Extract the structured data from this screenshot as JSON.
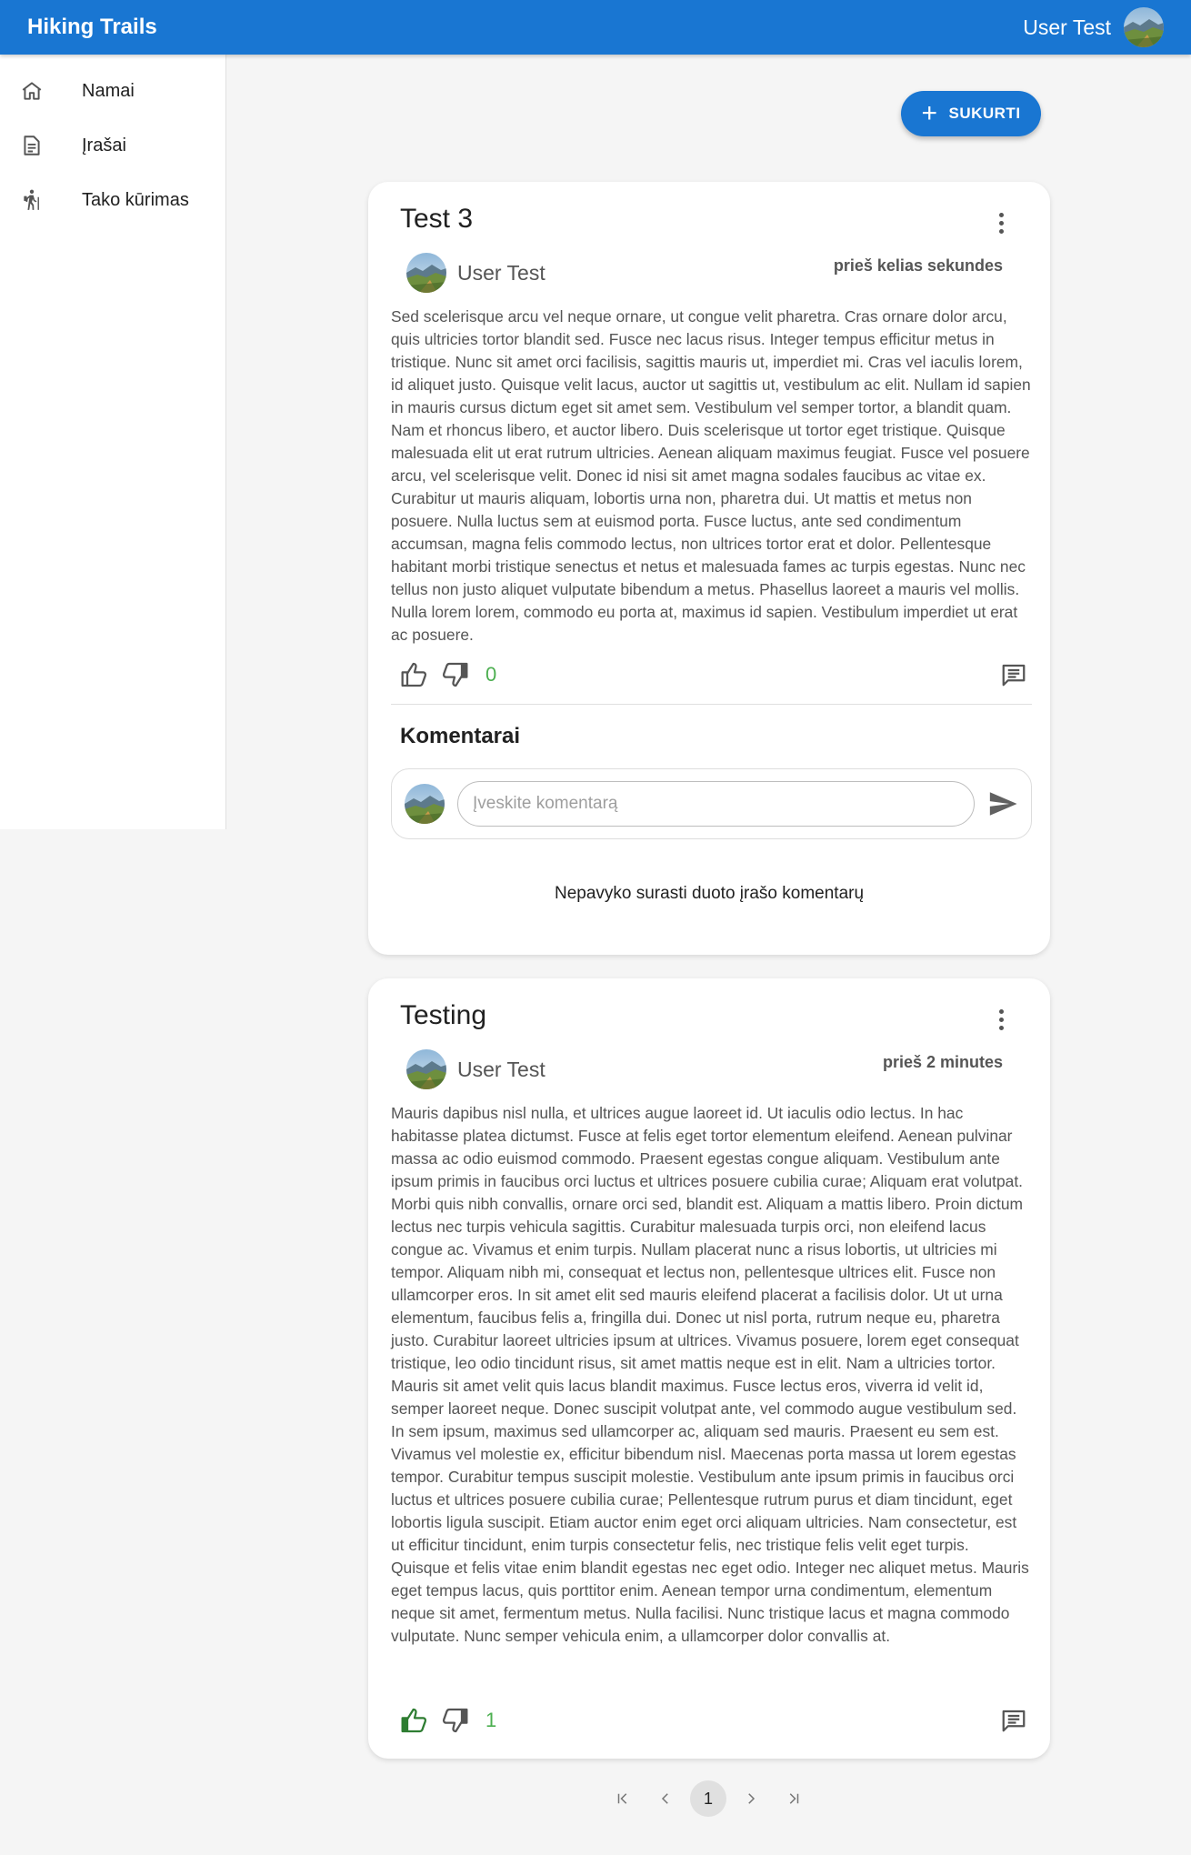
{
  "app": {
    "title": "Hiking Trails",
    "user_name": "User Test"
  },
  "sidebar": {
    "items": [
      {
        "label": "Namai",
        "icon": "home-icon"
      },
      {
        "label": "Įrašai",
        "icon": "article-icon"
      },
      {
        "label": "Tako kūrimas",
        "icon": "hiking-icon"
      }
    ]
  },
  "toolbar": {
    "create_label": "SUKURTI"
  },
  "posts": [
    {
      "title": "Test 3",
      "author": "User Test",
      "time": "prieš kelias sekundes",
      "body": "Sed scelerisque arcu vel neque ornare, ut congue velit pharetra. Cras ornare dolor arcu, quis ultricies tortor blandit sed. Fusce nec lacus risus. Integer tempus efficitur metus in tristique. Nunc sit amet orci facilisis, sagittis mauris ut, imperdiet mi. Cras vel iaculis lorem, id aliquet justo. Quisque velit lacus, auctor ut sagittis ut, vestibulum ac elit. Nullam id sapien in mauris cursus dictum eget sit amet sem. Vestibulum vel semper tortor, a blandit quam. Nam et rhoncus libero, et auctor libero. Duis scelerisque ut tortor eget tristique. Quisque malesuada elit ut erat rutrum ultricies. Aenean aliquam maximus feugiat. Fusce vel posuere arcu, vel scelerisque velit. Donec id nisi sit amet magna sodales faucibus ac vitae ex. Curabitur ut mauris aliquam, lobortis urna non, pharetra dui. Ut mattis et metus non posuere. Nulla luctus sem at euismod porta. Fusce luctus, ante sed condimentum accumsan, magna felis commodo lectus, non ultrices tortor erat et dolor. Pellentesque habitant morbi tristique senectus et netus et malesuada fames ac turpis egestas. Nunc nec tellus non justo aliquet vulputate bibendum a metus. Phasellus laoreet a mauris vel mollis. Nulla lorem lorem, commodo eu porta at, maximus id sapien. Vestibulum imperdiet ut erat ac posuere.",
      "likes": "0",
      "liked": false,
      "comments_heading": "Komentarai",
      "comment_placeholder": "Įveskite komentarą",
      "comments_empty": "Nepavyko surasti duoto įrašo komentarų"
    },
    {
      "title": "Testing",
      "author": "User Test",
      "time": "prieš 2 minutes",
      "body": "Mauris dapibus nisl nulla, et ultrices augue laoreet id. Ut iaculis odio lectus. In hac habitasse platea dictumst. Fusce at felis eget tortor elementum eleifend. Aenean pulvinar massa ac odio euismod commodo. Praesent egestas congue aliquam. Vestibulum ante ipsum primis in faucibus orci luctus et ultrices posuere cubilia curae; Aliquam erat volutpat. Morbi quis nibh convallis, ornare orci sed, blandit est. Aliquam a mattis libero. Proin dictum lectus nec turpis vehicula sagittis. Curabitur malesuada turpis orci, non eleifend lacus congue ac. Vivamus et enim turpis. Nullam placerat nunc a risus lobortis, ut ultricies mi tempor. Aliquam nibh mi, consequat et lectus non, pellentesque ultrices elit. Fusce non ullamcorper eros. In sit amet elit sed mauris eleifend placerat a facilisis dolor. Ut ut urna elementum, faucibus felis a, fringilla dui. Donec ut nisl porta, rutrum neque eu, pharetra justo. Curabitur laoreet ultricies ipsum at ultrices. Vivamus posuere, lorem eget consequat tristique, leo odio tincidunt risus, sit amet mattis neque est in elit. Nam a ultricies tortor. Mauris sit amet velit quis lacus blandit maximus. Fusce lectus eros, viverra id velit id, semper laoreet neque. Donec suscipit volutpat ante, vel commodo augue vestibulum sed. In sem ipsum, maximus sed ullamcorper ac, aliquam sed mauris. Praesent eu sem est. Vivamus vel molestie ex, efficitur bibendum nisl. Maecenas porta massa ut lorem egestas tempor. Curabitur tempus suscipit molestie. Vestibulum ante ipsum primis in faucibus orci luctus et ultrices posuere cubilia curae; Pellentesque rutrum purus et diam tincidunt, eget lobortis ligula suscipit. Etiam auctor enim eget orci aliquam ultricies. Nam consectetur, est ut efficitur tincidunt, enim turpis consectetur felis, nec tristique felis velit eget turpis. Quisque et felis vitae enim blandit egestas nec eget odio. Integer nec aliquet metus. Mauris eget tempus lacus, quis porttitor enim. Aenean tempor urna condimentum, elementum neque sit amet, fermentum metus. Nulla facilisi. Nunc tristique lacus et magna commodo vulputate. Nunc semper vehicula enim, a ullamcorper dolor convallis at.",
      "likes": "1",
      "liked": true
    }
  ],
  "pagination": {
    "current": "1"
  },
  "colors": {
    "primary": "#1976d2",
    "liked": "#2e7d32",
    "count": "#4caf50"
  }
}
